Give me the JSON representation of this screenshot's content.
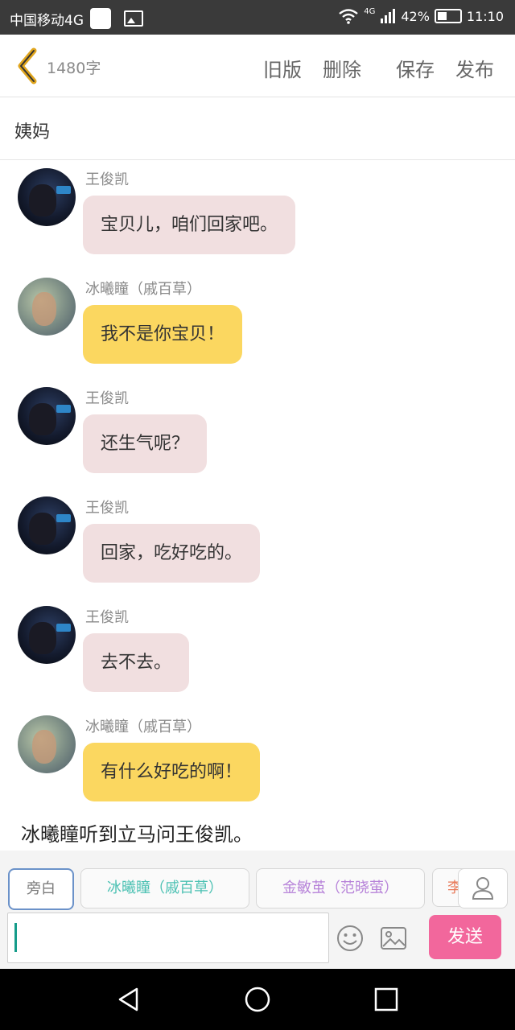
{
  "status_bar": {
    "carrier": "中国移动4G",
    "network": "4G",
    "battery_percent": "42%",
    "time": "11:10"
  },
  "top_bar": {
    "word_count": "1480字",
    "old_version_label": "旧版",
    "delete_label": "删除",
    "save_label": "保存",
    "publish_label": "发布",
    "back_icon": "chevron-left-icon"
  },
  "chapter": {
    "title": "姨妈"
  },
  "messages": [
    {
      "sender": "王俊凯",
      "text": "宝贝儿，咱们回家吧。",
      "style": "pink"
    },
    {
      "sender": "冰曦瞳（戚百草）",
      "text": "我不是你宝贝！",
      "style": "yellow"
    },
    {
      "sender": "王俊凯",
      "text": "还生气呢？",
      "style": "pink"
    },
    {
      "sender": "王俊凯",
      "text": "回家，吃好吃的。",
      "style": "pink"
    },
    {
      "sender": "王俊凯",
      "text": "去不去。",
      "style": "pink"
    },
    {
      "sender": "冰曦瞳（戚百草）",
      "text": "有什么好吃的啊！",
      "style": "yellow"
    }
  ],
  "narration": "冰曦瞳听到立马问王俊凯。",
  "input": {
    "roles": [
      {
        "label": "旁白",
        "color": "#7a7a7a"
      },
      {
        "label": "冰曦瞳（戚百草）",
        "color": "#4cc1b3"
      },
      {
        "label": "金敏茧（范晓萤）",
        "color": "#b783d9"
      },
      {
        "label": "李",
        "color": "#e87a5a"
      }
    ],
    "text_value": "",
    "send_label": "发送",
    "icons": [
      "person-icon",
      "emoji-icon",
      "image-icon"
    ]
  },
  "colors": {
    "pink_bubble": "#f1dfe0",
    "yellow_bubble": "#fbd760",
    "send_button": "#f2679c",
    "accent_back": "#e0a51d",
    "caret": "#159c8a"
  },
  "nav_icons": [
    "back-triangle-icon",
    "home-circle-icon",
    "recents-square-icon"
  ]
}
